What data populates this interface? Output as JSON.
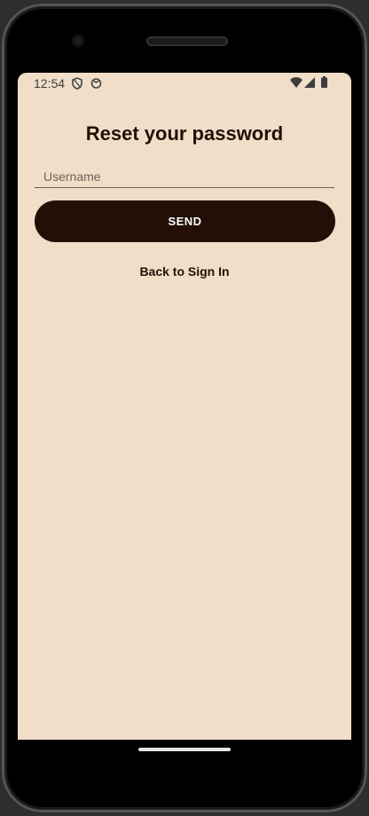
{
  "status_bar": {
    "time": "12:54"
  },
  "screen": {
    "title": "Reset your password",
    "username_placeholder": "Username",
    "send_label": "SEND",
    "back_link_label": "Back to Sign In"
  },
  "colors": {
    "background": "#f0dec9",
    "primary": "#230f05",
    "button_text": "#ffffff"
  },
  "icons": [
    "shield-icon",
    "face-icon",
    "wifi-icon",
    "signal-icon",
    "battery-icon"
  ]
}
